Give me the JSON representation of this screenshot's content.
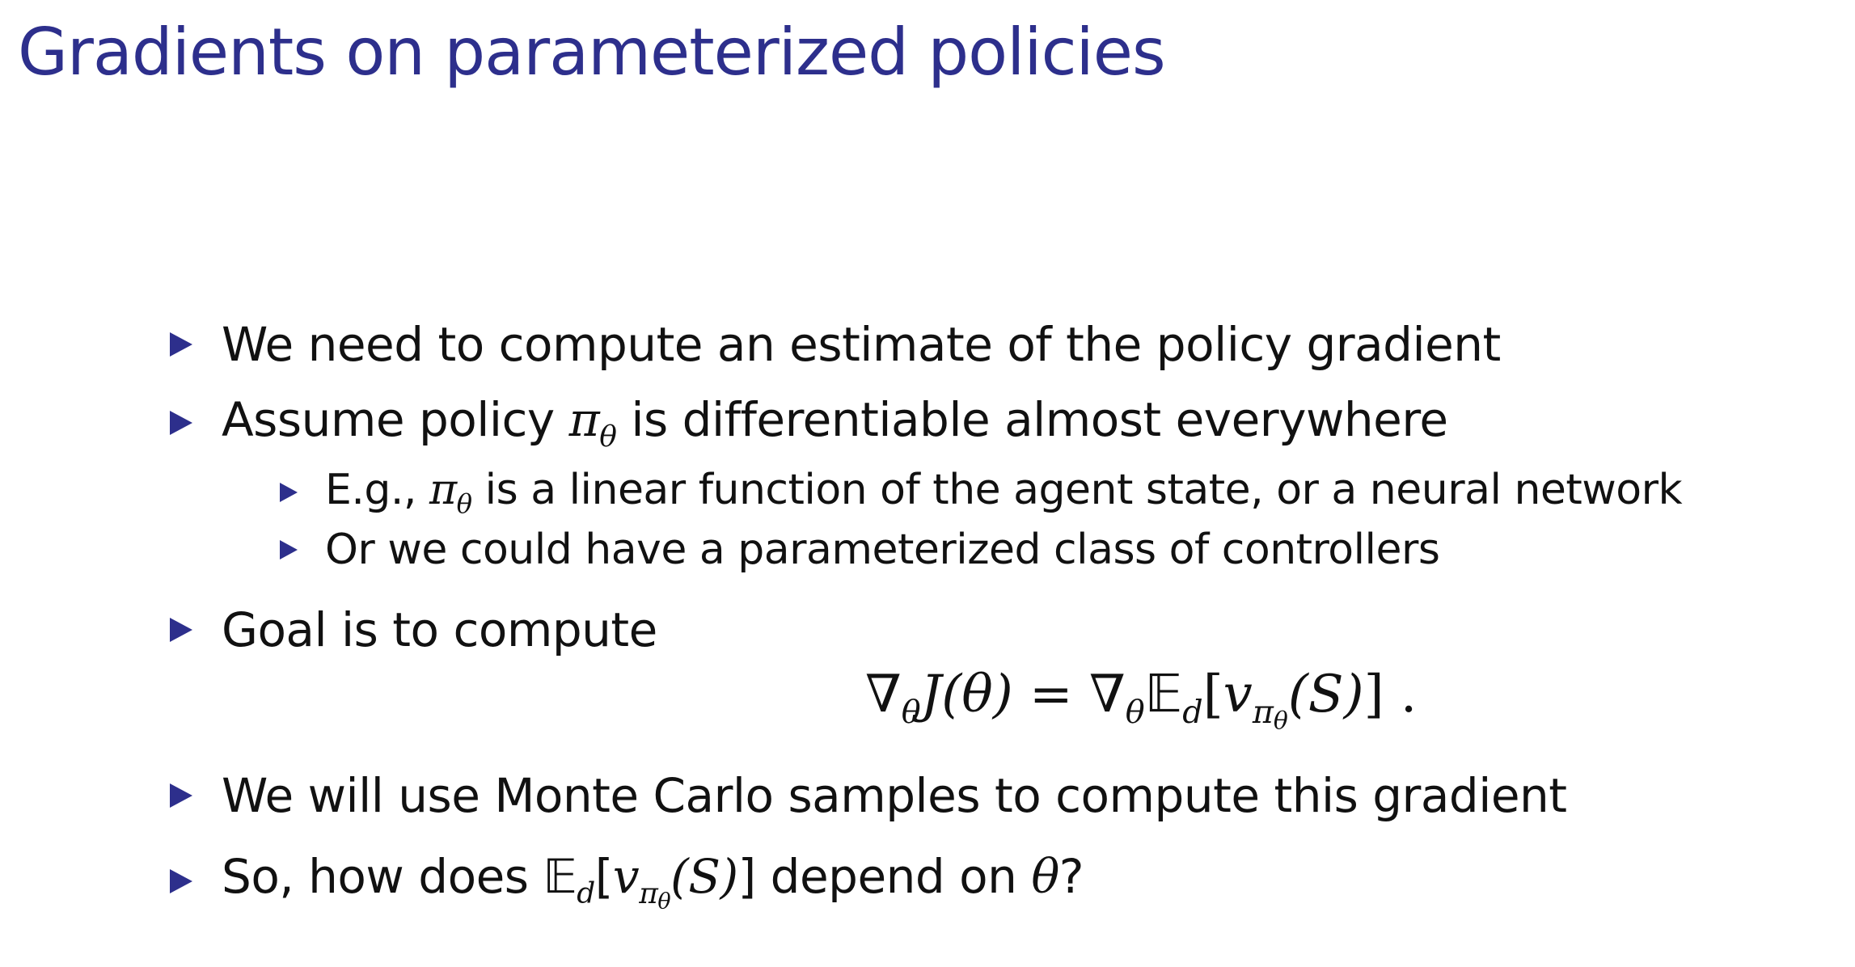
{
  "slide": {
    "title": "Gradients on parameterized policies",
    "bullets": {
      "b1": {
        "text": "We need to compute an estimate of the policy gradient"
      },
      "b2": {
        "before": "Assume policy ",
        "math_pi": "π",
        "math_theta": "θ",
        "after": " is differentiable almost everywhere"
      },
      "s1": {
        "before": "E.g., ",
        "math_pi": "π",
        "math_theta": "θ",
        "after": " is a linear function of the agent state, or a neural network"
      },
      "s2": {
        "text": "Or we could have a parameterized class of controllers"
      },
      "b3": {
        "text": "Goal is to compute"
      },
      "b4": {
        "text": "We will use Monte Carlo samples to compute this gradient"
      },
      "b5": {
        "before": "So, how does ",
        "E": "𝔼",
        "d": "d",
        "open": "[",
        "v": "v",
        "pi": "π",
        "theta_sub": "θ",
        "arg": "(S)",
        "close": "]",
        "after": " depend on ",
        "theta": "θ",
        "q": "?"
      }
    },
    "equation": {
      "nabla1": "∇",
      "theta1": "θ",
      "J": "J",
      "lhs_arg": "(θ)",
      "eq": " = ",
      "nabla2": "∇",
      "theta2": "θ",
      "E": "𝔼",
      "d": "d",
      "open": "[",
      "v": "v",
      "pi": "π",
      "theta3": "θ",
      "arg": "(S)",
      "close": "]",
      "period": " ."
    },
    "colors": {
      "title": "#2d2f8c",
      "bullet_marker": "#2d2f8c",
      "text": "#111111",
      "background": "#ffffff"
    },
    "icons": {
      "bullet": "triangle-bullet-icon"
    }
  }
}
